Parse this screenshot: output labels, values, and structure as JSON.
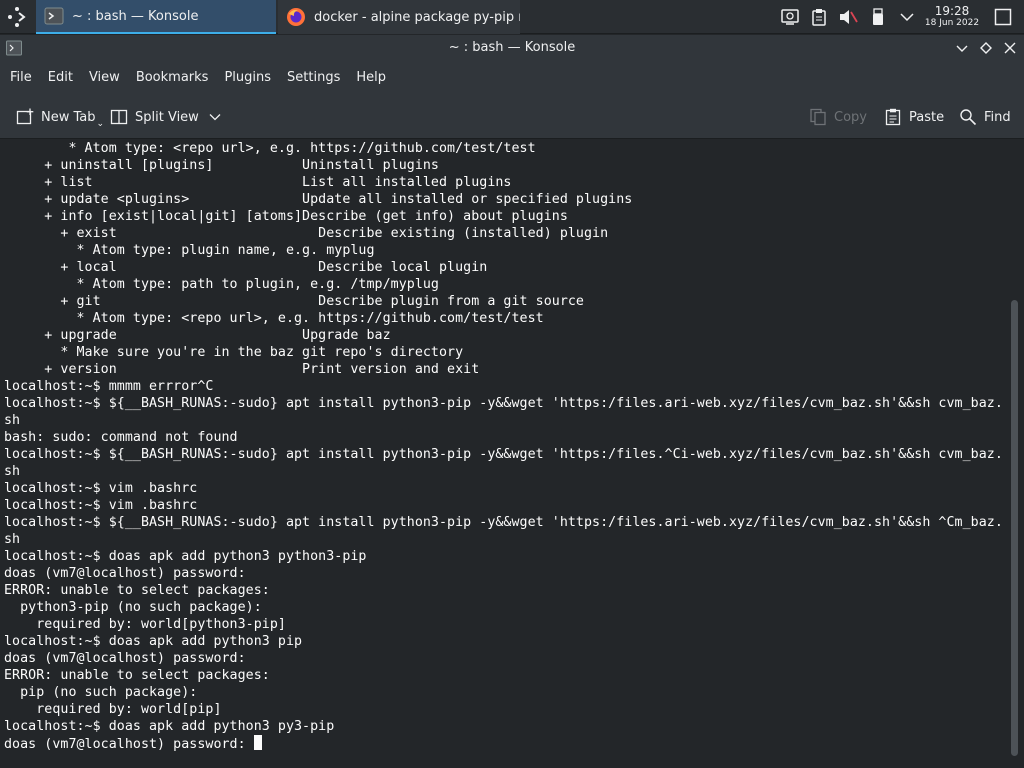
{
  "taskbar": {
    "tasks": [
      {
        "label": "~ : bash — Konsole"
      },
      {
        "label": "docker - alpine package py-pip m..."
      }
    ],
    "clock": {
      "time": "19:28",
      "date": "18 Jun 2022"
    }
  },
  "window": {
    "title": "~ : bash — Konsole"
  },
  "menubar": {
    "items": [
      "File",
      "Edit",
      "View",
      "Bookmarks",
      "Plugins",
      "Settings",
      "Help"
    ]
  },
  "toolbar": {
    "new_tab": "New Tab",
    "split_view": "Split View",
    "copy": "Copy",
    "paste": "Paste",
    "find": "Find"
  },
  "terminal": {
    "lines": [
      "        * Atom type: <repo url>, e.g. https://github.com/test/test",
      "     + uninstall [plugins]           Uninstall plugins",
      "     + list                          List all installed plugins",
      "     + update <plugins>              Update all installed or specified plugins",
      "     + info [exist|local|git] [atoms]Describe (get info) about plugins",
      "       + exist                         Describe existing (installed) plugin",
      "         * Atom type: plugin name, e.g. myplug",
      "       + local                         Describe local plugin",
      "         * Atom type: path to plugin, e.g. /tmp/myplug",
      "       + git                           Describe plugin from a git source",
      "         * Atom type: <repo url>, e.g. https://github.com/test/test",
      "     + upgrade                       Upgrade baz",
      "       * Make sure you're in the baz git repo's directory",
      "     + version                       Print version and exit",
      "localhost:~$ mmmm errror^C",
      "localhost:~$ ${__BASH_RUNAS:-sudo} apt install python3-pip -y&&wget 'https:/files.ari-web.xyz/files/cvm_baz.sh'&&sh cvm_baz.",
      "sh",
      "bash: sudo: command not found",
      "localhost:~$ ${__BASH_RUNAS:-sudo} apt install python3-pip -y&&wget 'https:/files.^Ci-web.xyz/files/cvm_baz.sh'&&sh cvm_baz.",
      "sh",
      "localhost:~$ vim .bashrc",
      "localhost:~$ vim .bashrc",
      "localhost:~$ ${__BASH_RUNAS:-sudo} apt install python3-pip -y&&wget 'https:/files.ari-web.xyz/files/cvm_baz.sh'&&sh ^Cm_baz.",
      "sh",
      "localhost:~$ doas apk add python3 python3-pip",
      "doas (vm7@localhost) password:",
      "ERROR: unable to select packages:",
      "  python3-pip (no such package):",
      "    required by: world[python3-pip]",
      "localhost:~$ doas apk add python3 pip",
      "doas (vm7@localhost) password:",
      "ERROR: unable to select packages:",
      "  pip (no such package):",
      "    required by: world[pip]",
      "localhost:~$ doas apk add python3 py3-pip",
      "doas (vm7@localhost) password: "
    ]
  }
}
